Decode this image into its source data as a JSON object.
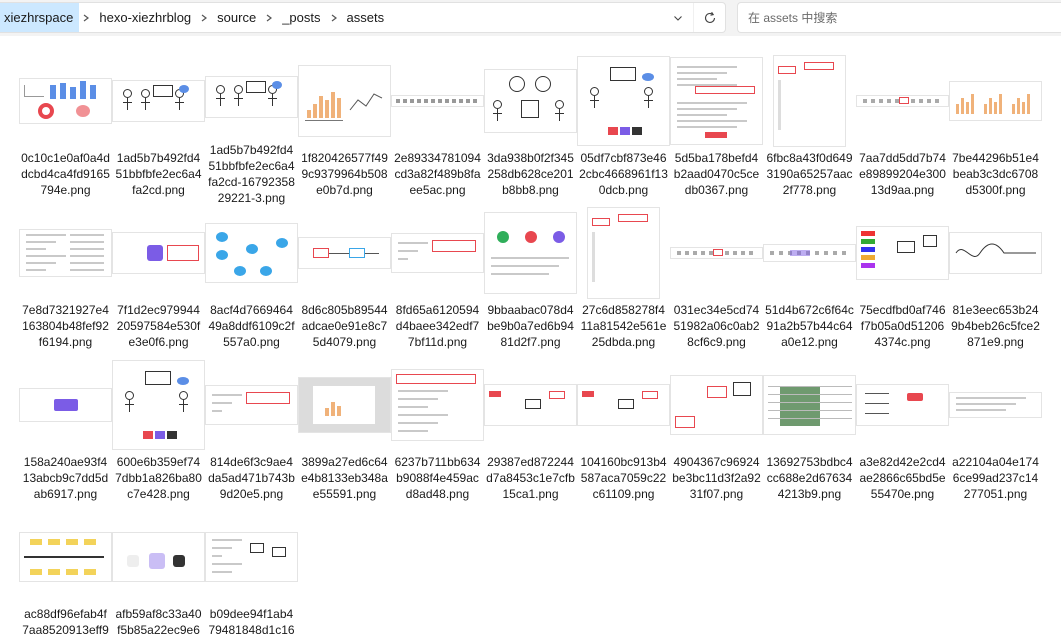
{
  "address_bar": {
    "crumbs": [
      "xiezhrspace",
      "hexo-xiezhrblog",
      "source",
      "_posts",
      "assets"
    ]
  },
  "search": {
    "placeholder": "在 assets 中搜索"
  },
  "colors": {
    "selected_crumb": "#cce8ff",
    "accent_red": "#e8474f",
    "accent_blue": "#5b8ee6",
    "accent_purple": "#7b5ce6",
    "accent_green": "#2fae5a",
    "chart_orange": "#f0b27a"
  },
  "files": [
    {
      "name": "0c10c1e0af0a4ddcbd4ca4fd9165794e.png",
      "thumb": "dash"
    },
    {
      "name": "1ad5b7b492fd451bbfbfe2ec6a4fa2cd.png",
      "thumb": "sketch"
    },
    {
      "name": "1ad5b7b492fd451bbfbfe2ec6a4fa2cd-1679235829221-3.png",
      "thumb": "sketch"
    },
    {
      "name": "1f820426577f499c9379964b508e0b7d.png",
      "thumb": "barchart"
    },
    {
      "name": "2e89334781094cd3a82f489b8faee5ac.png",
      "thumb": "toolbar"
    },
    {
      "name": "3da938b0f2f345258db628ce201b8bb8.png",
      "thumb": "sketch2"
    },
    {
      "name": "05df7cbf873e462cbc4668961f130dcb.png",
      "thumb": "sketch3"
    },
    {
      "name": "5d5ba178befd4b2aad0470c5cedb0367.png",
      "thumb": "dialog"
    },
    {
      "name": "6fbc8a43f0d6493190a65257aac2f778.png",
      "thumb": "canvas"
    },
    {
      "name": "7aa7dd5dd7b74e89899204e30013d9aa.png",
      "thumb": "strip"
    },
    {
      "name": "7be44296b51e4beab3c3dc6708d5300f.png",
      "thumb": "charts2"
    },
    {
      "name": "7e8d7321927e4163804b48fef92f6194.png",
      "thumb": "docs"
    },
    {
      "name": "7f1d2ec97994420597584e530fe3e0f6.png",
      "thumb": "button"
    },
    {
      "name": "8acf4d766946449a8ddf6109c2f557a0.png",
      "thumb": "network"
    },
    {
      "name": "8d6c805b89544adcae0e91e8c75d4079.png",
      "thumb": "flow"
    },
    {
      "name": "8fd65a6120594d4baee342edf77bf11d.png",
      "thumb": "form"
    },
    {
      "name": "9bbaabac078d4be9b0a7ed6b9481d2f7.png",
      "thumb": "icons"
    },
    {
      "name": "27c6d858278f411a81542e561e25dbda.png",
      "thumb": "canvas"
    },
    {
      "name": "031ec34e5cd7451982a06c0ab28cf6c9.png",
      "thumb": "strip"
    },
    {
      "name": "51d4b672c6f64c91a2b57b44c64a0e12.png",
      "thumb": "strip2"
    },
    {
      "name": "75ecdfbd0af746f7b05a0d512064374c.png",
      "thumb": "palette"
    },
    {
      "name": "81e3eec653b249b4beb26c5fce2871e9.png",
      "thumb": "squiggle"
    },
    {
      "name": "158a240ae93f413abcb9c7dd5dab6917.png",
      "thumb": "button2"
    },
    {
      "name": "600e6b359ef747dbb1a826ba80c7e428.png",
      "thumb": "sketch3"
    },
    {
      "name": "814de6f3c9ae4da5ad471b743b9d20e5.png",
      "thumb": "form"
    },
    {
      "name": "3899a27ed6c64e4b8133eb348ae55591.png",
      "thumb": "graycard"
    },
    {
      "name": "6237b711bb634b9088f4e459acd8ad48.png",
      "thumb": "menu"
    },
    {
      "name": "29387ed872244d7a8453c1e7cfb15ca1.png",
      "thumb": "canvas2"
    },
    {
      "name": "104160bc913b4587aca7059c22c61109.png",
      "thumb": "canvas2"
    },
    {
      "name": "4904367c96924be3bc11d3f2a9231f07.png",
      "thumb": "palette2"
    },
    {
      "name": "13692753bdbc4cc688e2d676344213b9.png",
      "thumb": "sheet"
    },
    {
      "name": "a3e82d42e2cd4ae2866c65bd5e55470e.png",
      "thumb": "arrows"
    },
    {
      "name": "a22104a04e1746ce99ad237c14277051.png",
      "thumb": "panel"
    },
    {
      "name": "ac88df96efab4f7aa8520913eff9e051.png",
      "thumb": "fishbone"
    },
    {
      "name": "afb59af8c33a40f5b85a22ec9e68d3cb.png",
      "thumb": "fill"
    },
    {
      "name": "b09dee94f1ab479481848d1c1625d067.png",
      "thumb": "editor"
    }
  ]
}
